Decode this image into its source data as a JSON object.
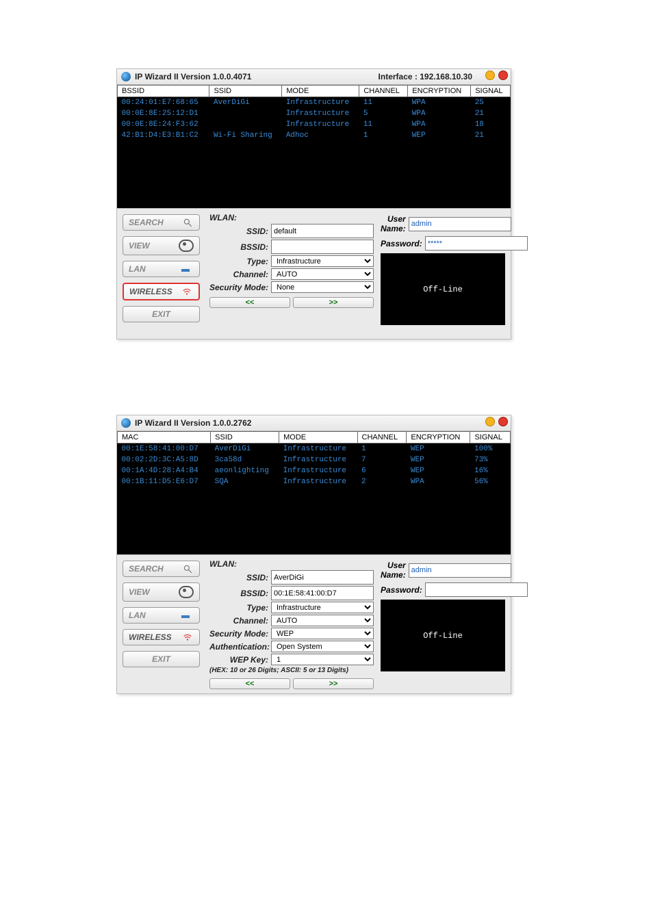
{
  "windows": [
    {
      "title": "IP Wizard II  Version 1.0.0.4071",
      "interface_label": "Interface :",
      "interface_addr": "192.168.10.30",
      "columns": {
        "c0": "BSSID",
        "c1": "SSID",
        "c2": "MODE",
        "c3": "CHANNEL",
        "c4": "ENCRYPTION",
        "c5": "SIGNAL"
      },
      "rows": [
        {
          "c0": "00:24:01:E7:68:65",
          "c1": "AverDiGi",
          "c2": "Infrastructure",
          "c3": "11",
          "c4": "WPA",
          "c5": "25"
        },
        {
          "c0": "00:0E:8E:25:12:D1",
          "c1": "",
          "c2": "Infrastructure",
          "c3": "5",
          "c4": "WPA",
          "c5": "21"
        },
        {
          "c0": "00:0E:8E:24:F3:62",
          "c1": "",
          "c2": "Infrastructure",
          "c3": "11",
          "c4": "WPA",
          "c5": "18"
        },
        {
          "c0": "42:B1:D4:E3:B1:C2",
          "c1": "Wi-Fi Sharing",
          "c2": "Adhoc",
          "c3": "1",
          "c4": "WEP",
          "c5": "21"
        }
      ],
      "nav": {
        "search": "SEARCH",
        "view": "VIEW",
        "lan": "LAN",
        "wireless": "WIRELESS",
        "exit": "EXIT",
        "active": "wireless"
      },
      "wlan": {
        "heading": "WLAN:",
        "labels": {
          "ssid": "SSID:",
          "bssid": "BSSID:",
          "type": "Type:",
          "channel": "Channel:",
          "secmode": "Security Mode:"
        },
        "ssid": "default",
        "bssid": "",
        "type": "Infrastructure",
        "channel": "AUTO",
        "secmode": "None",
        "show_auth": false
      },
      "cred": {
        "user_label": "User Name:",
        "pass_label": "Password:",
        "user": "admin",
        "pass": "*****"
      },
      "preview_text": "Off-Line",
      "pager": {
        "prev": "<<",
        "next": ">>"
      }
    },
    {
      "title": "IP Wizard II  Version 1.0.0.2762",
      "interface_label": "",
      "interface_addr": "",
      "columns": {
        "c0": "MAC",
        "c1": "SSID",
        "c2": "MODE",
        "c3": "CHANNEL",
        "c4": "ENCRYPTION",
        "c5": "SIGNAL"
      },
      "rows": [
        {
          "c0": "00:1E:58:41:00:D7",
          "c1": "AverDiGi",
          "c2": "Infrastructure",
          "c3": "1",
          "c4": "WEP",
          "c5": "100%"
        },
        {
          "c0": "00:02:2D:3C:A5:8D",
          "c1": "3ca58d",
          "c2": "Infrastructure",
          "c3": "7",
          "c4": "WEP",
          "c5": "73%"
        },
        {
          "c0": "00:1A:4D:28:A4:B4",
          "c1": "aeonlighting",
          "c2": "Infrastructure",
          "c3": "6",
          "c4": "WEP",
          "c5": "16%"
        },
        {
          "c0": "00:1B:11:D5:E6:D7",
          "c1": "SQA",
          "c2": "Infrastructure",
          "c3": "2",
          "c4": "WPA",
          "c5": "56%"
        }
      ],
      "nav": {
        "search": "SEARCH",
        "view": "VIEW",
        "lan": "LAN",
        "wireless": "WIRELESS",
        "exit": "EXIT",
        "active": ""
      },
      "wlan": {
        "heading": "WLAN:",
        "labels": {
          "ssid": "SSID:",
          "bssid": "BSSID:",
          "type": "Type:",
          "channel": "Channel:",
          "secmode": "Security Mode:",
          "auth": "Authentication:",
          "wepkey": "WEP Key:"
        },
        "ssid": "AverDiGi",
        "bssid": "00:1E:58:41:00:D7",
        "type": "Infrastructure",
        "channel": "AUTO",
        "secmode": "WEP",
        "auth": "Open System",
        "wepkey": "1",
        "hexnote": "(HEX: 10 or 26 Digits; ASCII: 5 or 13 Digits)",
        "show_auth": true
      },
      "cred": {
        "user_label": "User Name:",
        "pass_label": "Password:",
        "user": "admin",
        "pass": ""
      },
      "preview_text": "Off-Line",
      "pager": {
        "prev": "<<",
        "next": ">>"
      }
    }
  ]
}
